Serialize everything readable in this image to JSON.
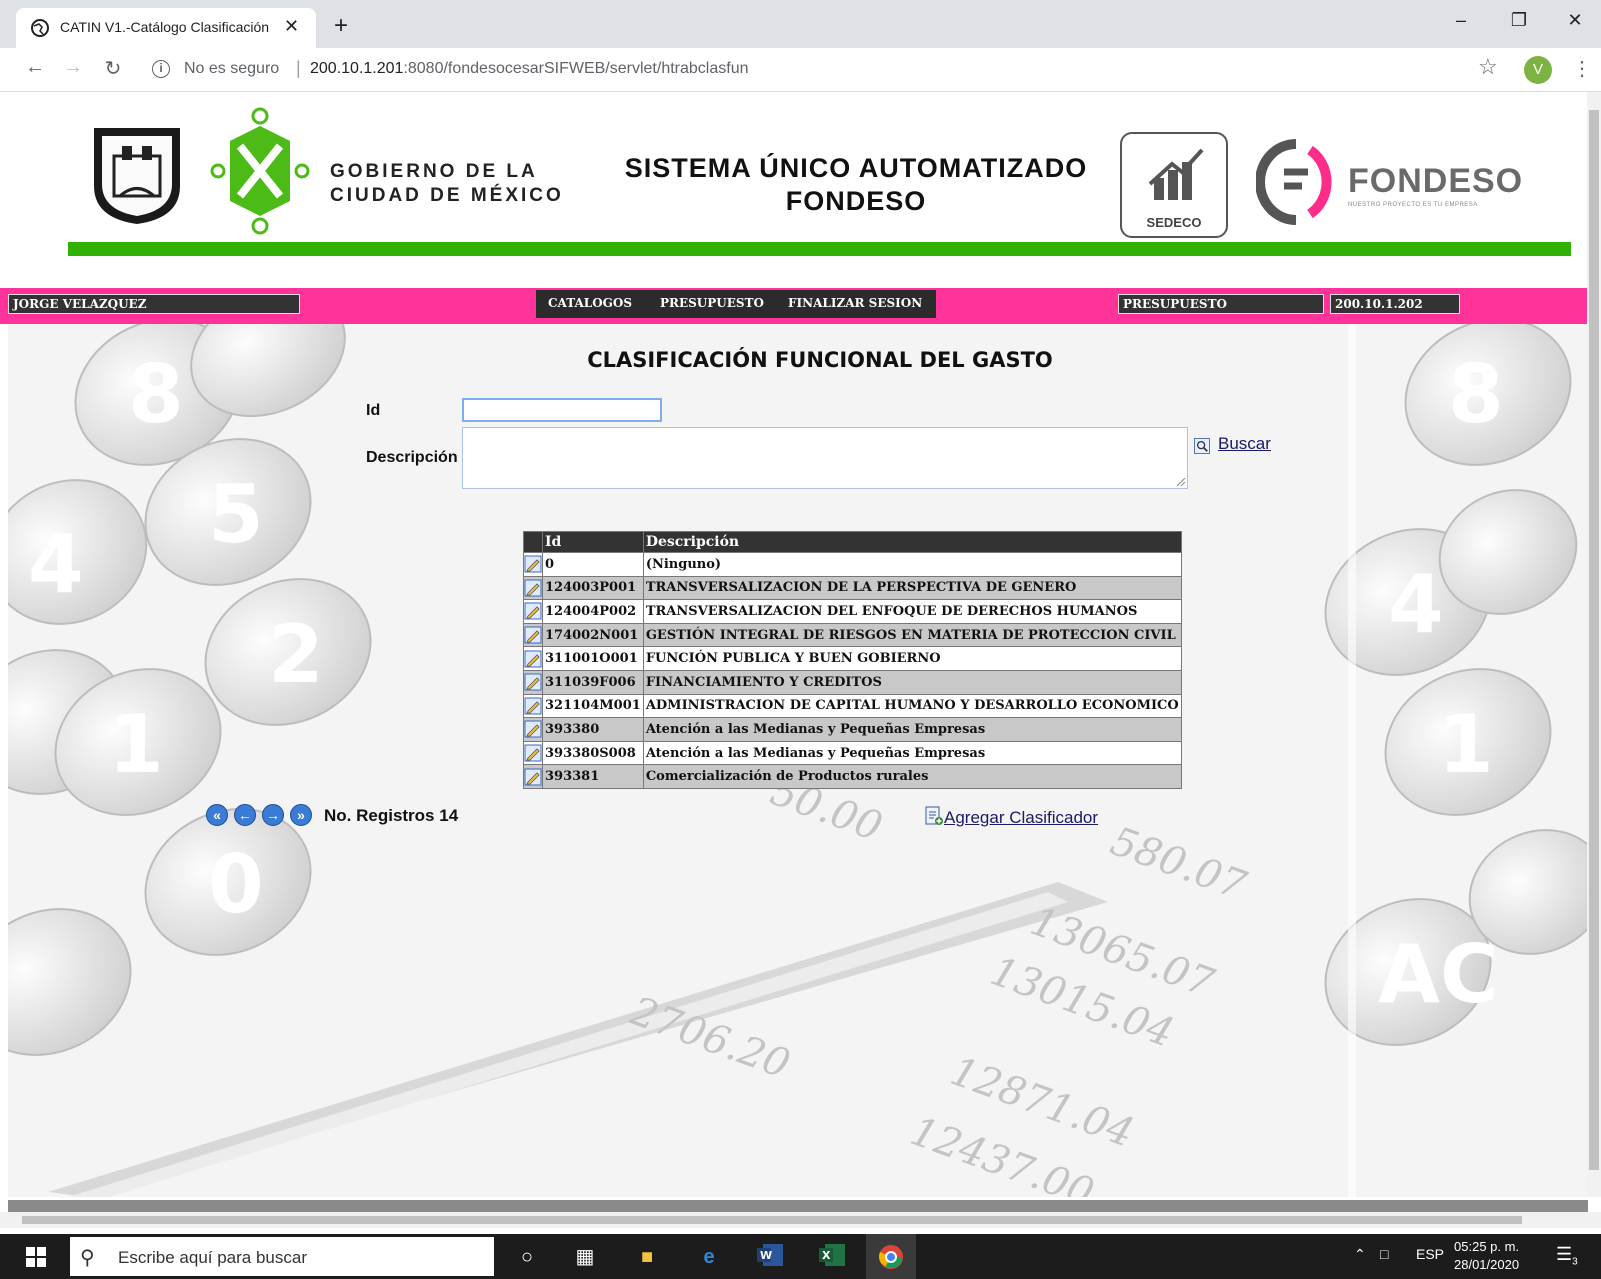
{
  "browser": {
    "tab_title": "CATIN V1.-Catálogo Clasificación",
    "tab_close": "✕",
    "new_tab": "+",
    "not_secure": "No es seguro",
    "url_host": "200.10.1.201",
    "url_rest": ":8080/fondesocesarSIFWEB/servlet/htrabclasfun",
    "profile_initial": "V"
  },
  "banner": {
    "gov_line1": "GOBIERNO DE LA",
    "gov_line2": "CIUDAD DE MÉXICO",
    "system_line1": "SISTEMA ÚNICO AUTOMATIZADO",
    "system_line2": "FONDESO",
    "sedeco_label": "SEDECO",
    "fondeso_label": "FONDESO",
    "fondeso_tagline": "NUESTRO PROYECTO ES TU EMPRESA"
  },
  "menubar": {
    "user": "JORGE VELAZQUEZ",
    "items": [
      {
        "label": "CATALOGOS"
      },
      {
        "label": "PRESUPUESTO"
      },
      {
        "label": "FINALIZAR SESION"
      }
    ],
    "module": "PRESUPUESTO",
    "ip": "200.10.1.202"
  },
  "form": {
    "title": "CLASIFICACIÓN FUNCIONAL DEL GASTO",
    "id_label": "Id",
    "id_value": "",
    "desc_label": "Descripción",
    "desc_value": "",
    "search_label": "Buscar"
  },
  "table": {
    "headers": [
      "Id",
      "Descripción"
    ],
    "rows": [
      {
        "id": "0",
        "desc": "(Ninguno)"
      },
      {
        "id": "124003P001",
        "desc": "TRANSVERSALIZACION DE LA PERSPECTIVA DE GENERO"
      },
      {
        "id": "124004P002",
        "desc": "TRANSVERSALIZACION DEL ENFOQUE DE DERECHOS HUMANOS"
      },
      {
        "id": "174002N001",
        "desc": "GESTIÓN INTEGRAL DE RIESGOS EN MATERIA DE PROTECCION CIVIL"
      },
      {
        "id": "311001O001",
        "desc": "FUNCIÓN PUBLICA Y BUEN GOBIERNO"
      },
      {
        "id": "311039F006",
        "desc": "FINANCIAMIENTO Y CREDITOS"
      },
      {
        "id": "321104M001",
        "desc": "ADMINISTRACION DE CAPITAL HUMANO Y DESARROLLO ECONOMICO"
      },
      {
        "id": "393380",
        "desc": "Atención a las Medianas y Pequeñas Empresas"
      },
      {
        "id": "393380S008",
        "desc": "Atención a las Medianas y Pequeñas Empresas"
      },
      {
        "id": "393381",
        "desc": "Comercialización de Productos rurales"
      }
    ]
  },
  "pager": {
    "records_label": "No. Registros 14"
  },
  "actions": {
    "add_label": "Agregar Clasificador"
  },
  "taskbar": {
    "search_placeholder": "Escribe aquí para buscar",
    "lang": "ESP",
    "time": "05:25 p. m.",
    "date": "28/01/2020",
    "notif_count": "3"
  },
  "colors": {
    "accent_pink": "#ff3399",
    "accent_green": "#2fb203",
    "header_dark": "#333333"
  }
}
